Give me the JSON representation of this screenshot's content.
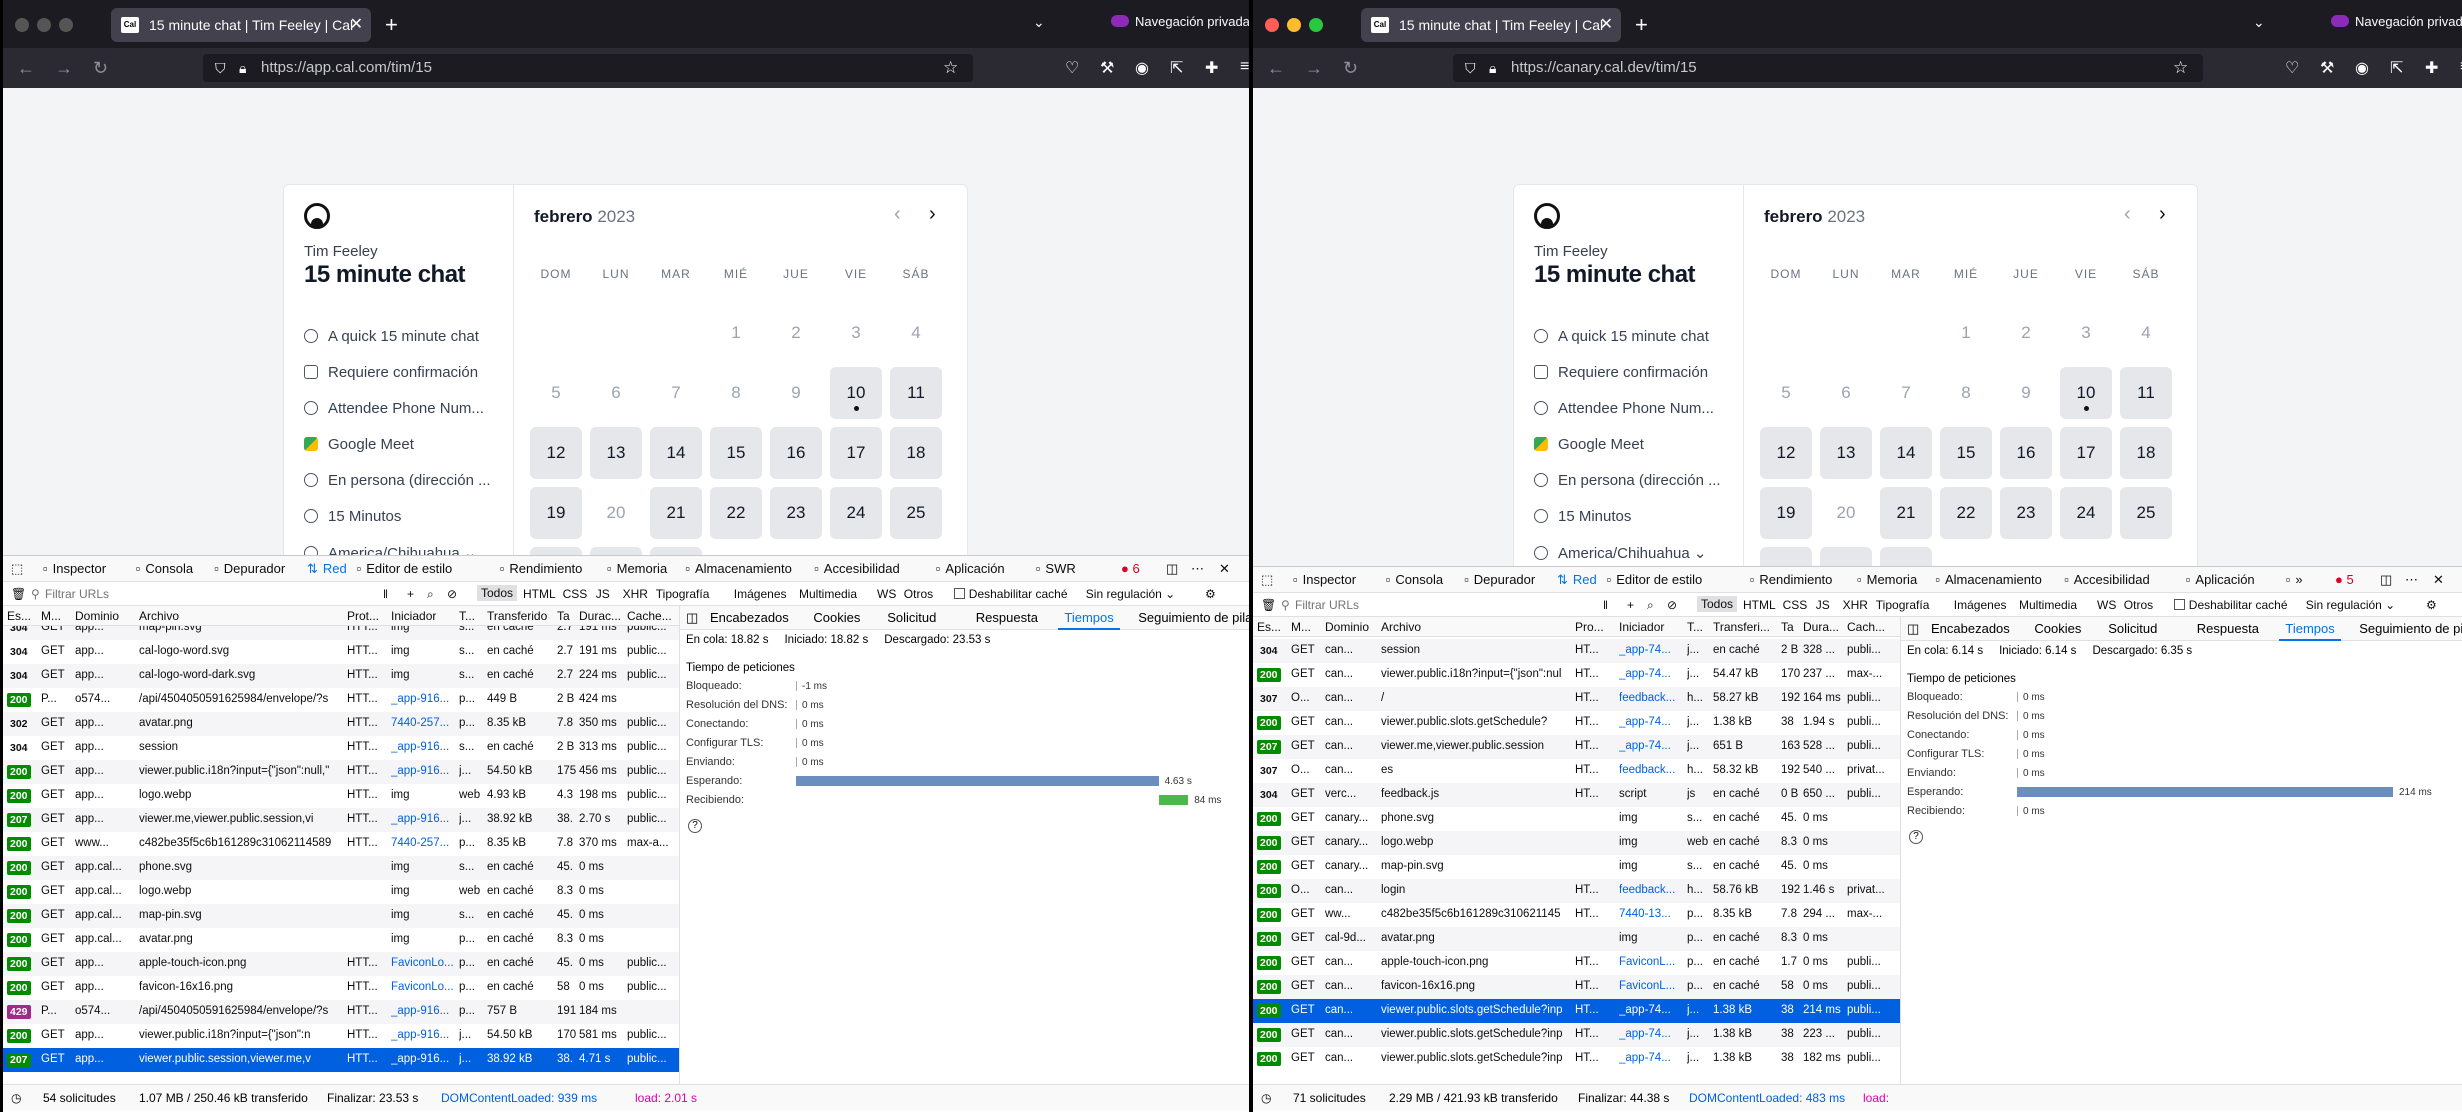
{
  "left": {
    "tab_title": "15 minute chat | Tim Feeley | Cal",
    "tab_close": "✕",
    "new_tab": "+",
    "chevron": "⌄",
    "private_label": "Navegación privada",
    "url": "https://app.cal.com/tim/15",
    "host_name": "Tim Feeley",
    "event_title": "15 minute chat",
    "info": [
      "A quick 15 minute chat",
      "Requiere confirmación",
      "Attendee Phone Num...",
      "Google Meet",
      "En persona (dirección ...",
      "15 Minutos",
      "America/Chihuahua ⌄"
    ],
    "month": "febrero",
    "year": "2023",
    "dow": [
      "DOM",
      "LUN",
      "MAR",
      "MIÉ",
      "JUE",
      "VIE",
      "SÁB"
    ],
    "devtools_tabs": [
      "Inspector",
      "Consola",
      "Depurador",
      "Red",
      "Editor de estilo",
      "Rendimiento",
      "Memoria",
      "Almacenamiento",
      "Accesibilidad",
      "Aplicación",
      "SWR"
    ],
    "error_count": "6",
    "filter_placeholder": "Filtrar URLs",
    "filter_types": [
      "Todos",
      "HTML",
      "CSS",
      "JS",
      "XHR",
      "Tipografía",
      "Imágenes",
      "Multimedia",
      "WS",
      "Otros"
    ],
    "disable_cache": "Deshabilitar caché",
    "throttle": "Sin regulación ⌄",
    "columns": [
      "Es...",
      "M...",
      "Dominio",
      "Archivo",
      "Prot...",
      "Iniciador",
      "T...",
      "Transferido",
      "Ta",
      "Durac...",
      "Cache..."
    ],
    "rows": [
      [
        "304",
        "GET",
        "app...",
        "map-pin.svg",
        "HTT...",
        "img",
        "s...",
        "en caché",
        "2.7",
        "191 ms",
        "public..."
      ],
      [
        "304",
        "GET",
        "app...",
        "cal-logo-word.svg",
        "HTT...",
        "img",
        "s...",
        "en caché",
        "2.7",
        "191 ms",
        "public..."
      ],
      [
        "304",
        "GET",
        "app...",
        "cal-logo-word-dark.svg",
        "HTT...",
        "img",
        "s...",
        "en caché",
        "2.7",
        "224 ms",
        "public..."
      ],
      [
        "200",
        "P...",
        "o574...",
        "/api/4504050591625984/envelope/?s",
        "HTT...",
        "_app-916...",
        "p...",
        "449 B",
        "2 B",
        "424 ms",
        ""
      ],
      [
        "302",
        "GET",
        "app...",
        "avatar.png",
        "HTT...",
        "7440-257...",
        "p...",
        "8.35 kB",
        "7.8",
        "350 ms",
        "public..."
      ],
      [
        "304",
        "GET",
        "app...",
        "session",
        "HTT...",
        "_app-916...",
        "s...",
        "en caché",
        "2 B",
        "313 ms",
        "public..."
      ],
      [
        "200",
        "GET",
        "app...",
        "viewer.public.i18n?input={\"json\":null,\"",
        "HTT...",
        "_app-916...",
        "j...",
        "54.50 kB",
        "175",
        "456 ms",
        "public..."
      ],
      [
        "200",
        "GET",
        "app...",
        "logo.webp",
        "HTT...",
        "img",
        "web",
        "4.93 kB",
        "4.3",
        "198 ms",
        "public..."
      ],
      [
        "207",
        "GET",
        "app...",
        "viewer.me,viewer.public.session,vi",
        "HTT...",
        "_app-916...",
        "j...",
        "38.92 kB",
        "38.",
        "2.70 s",
        "public..."
      ],
      [
        "200",
        "GET",
        "www...",
        "c482be35f5c6b161289c31062114589",
        "HTT...",
        "7440-257...",
        "p...",
        "8.35 kB",
        "7.8",
        "370 ms",
        "max-a..."
      ],
      [
        "200",
        "GET",
        "app.cal...",
        "phone.svg",
        "",
        "img",
        "s...",
        "en caché",
        "45.",
        "0 ms",
        ""
      ],
      [
        "200",
        "GET",
        "app.cal...",
        "logo.webp",
        "",
        "img",
        "web",
        "en caché",
        "8.3",
        "0 ms",
        ""
      ],
      [
        "200",
        "GET",
        "app.cal...",
        "map-pin.svg",
        "",
        "img",
        "s...",
        "en caché",
        "45.",
        "0 ms",
        ""
      ],
      [
        "200",
        "GET",
        "app.cal...",
        "avatar.png",
        "",
        "img",
        "p...",
        "en caché",
        "8.3",
        "0 ms",
        ""
      ],
      [
        "200",
        "GET",
        "app...",
        "apple-touch-icon.png",
        "HTT...",
        "FaviconLo...",
        "p...",
        "en caché",
        "45.",
        "0 ms",
        "public..."
      ],
      [
        "200",
        "GET",
        "app...",
        "favicon-16x16.png",
        "HTT...",
        "FaviconLo...",
        "p...",
        "en caché",
        "58",
        "0 ms",
        "public..."
      ],
      [
        "429",
        "P...",
        "o574...",
        "/api/4504050591625984/envelope/?s",
        "HTT...",
        "_app-916...",
        "p...",
        "757 B",
        "191",
        "184 ms",
        ""
      ],
      [
        "200",
        "GET",
        "app...",
        "viewer.public.i18n?input={\"json\":n",
        "HTT...",
        "_app-916...",
        "j...",
        "54.50 kB",
        "170",
        "581 ms",
        "public..."
      ],
      [
        "207",
        "GET",
        "app...",
        "viewer.public.session,viewer.me,v",
        "HTT...",
        "_app-916...",
        "j...",
        "38.92 kB",
        "38.",
        "4.71 s",
        "public..."
      ]
    ],
    "side_tabs": [
      "Encabezados",
      "Cookies",
      "Solicitud",
      "Respuesta",
      "Tiempos",
      "Seguimiento de pila"
    ],
    "queued": "En cola: 18.82 s",
    "started": "Iniciado: 18.82 s",
    "downloaded": "Descargado: 23.53 s",
    "timing_title": "Tiempo de peticiones",
    "timings": [
      {
        "label": "Bloqueado:",
        "value": "-1 ms",
        "bar": 0
      },
      {
        "label": "Resolución del DNS:",
        "value": "0 ms",
        "bar": 0
      },
      {
        "label": "Conectando:",
        "value": "0 ms",
        "bar": 0
      },
      {
        "label": "Configurar TLS:",
        "value": "0 ms",
        "bar": 0
      },
      {
        "label": "Enviando:",
        "value": "0 ms",
        "bar": 0
      },
      {
        "label": "Esperando:",
        "value": "4.63 s",
        "bar": 0.98
      },
      {
        "label": "Recibiendo:",
        "value": "84 ms",
        "bar": 0.02
      }
    ],
    "status_requests": "54 solicitudes",
    "status_size": "1.07 MB / 250.46 kB transferido",
    "status_finish": "Finalizar: 23.53 s",
    "status_dcl": "DOMContentLoaded: 939 ms",
    "status_load": "load: 2.01 s"
  },
  "right": {
    "tab_title": "15 minute chat | Tim Feeley | Cal",
    "tab_close": "✕",
    "new_tab": "+",
    "chevron": "⌄",
    "private_label": "Navegación privada",
    "url": "https://canary.cal.dev/tim/15",
    "host_name": "Tim Feeley",
    "event_title": "15 minute chat",
    "info": [
      "A quick 15 minute chat",
      "Requiere confirmación",
      "Attendee Phone Num...",
      "Google Meet",
      "En persona (dirección ...",
      "15 Minutos",
      "America/Chihuahua ⌄"
    ],
    "month": "febrero",
    "year": "2023",
    "dow": [
      "DOM",
      "LUN",
      "MAR",
      "MIÉ",
      "JUE",
      "VIE",
      "SÁB"
    ],
    "devtools_tabs": [
      "Inspector",
      "Consola",
      "Depurador",
      "Red",
      "Editor de estilo",
      "Rendimiento",
      "Memoria",
      "Almacenamiento",
      "Accesibilidad",
      "Aplicación",
      "»"
    ],
    "error_count": "5",
    "filter_placeholder": "Filtrar URLs",
    "filter_types": [
      "Todos",
      "HTML",
      "CSS",
      "JS",
      "XHR",
      "Tipografía",
      "Imágenes",
      "Multimedia",
      "WS",
      "Otros"
    ],
    "disable_cache": "Deshabilitar caché",
    "throttle": "Sin regulación ⌄",
    "columns": [
      "Es...",
      "M...",
      "Dominio",
      "Archivo",
      "Pro...",
      "Iniciador",
      "T...",
      "Transferi...",
      "Ta",
      "Dura...",
      "Cach..."
    ],
    "rows": [
      [
        "304",
        "GET",
        "can...",
        "session",
        "HT...",
        "_app-74...",
        "j...",
        "en caché",
        "2 B",
        "328 ...",
        "publi..."
      ],
      [
        "200",
        "GET",
        "can...",
        "viewer.public.i18n?input={\"json\":nul",
        "HT...",
        "_app-74...",
        "j...",
        "54.47 kB",
        "170",
        "237 ...",
        "max-..."
      ],
      [
        "307",
        "O...",
        "can...",
        "/",
        "HT...",
        "feedback...",
        "h...",
        "58.27 kB",
        "192",
        "164 ms",
        "publi..."
      ],
      [
        "200",
        "GET",
        "can...",
        "viewer.public.slots.getSchedule?",
        "HT...",
        "_app-74...",
        "j...",
        "1.38 kB",
        "38",
        "1.94 s",
        "publi..."
      ],
      [
        "207",
        "GET",
        "can...",
        "viewer.me,viewer.public.session",
        "HT...",
        "_app-74...",
        "j...",
        "651 B",
        "163",
        "528 ...",
        "publi..."
      ],
      [
        "307",
        "O...",
        "can...",
        "es",
        "HT...",
        "feedback...",
        "h...",
        "58.32 kB",
        "192",
        "540 ...",
        "privat..."
      ],
      [
        "304",
        "GET",
        "verc...",
        "feedback.js",
        "HT...",
        "script",
        "js",
        "en caché",
        "0 B",
        "650 ...",
        "publi..."
      ],
      [
        "200",
        "GET",
        "canary...",
        "phone.svg",
        "",
        "img",
        "s...",
        "en caché",
        "45.",
        "0 ms",
        ""
      ],
      [
        "200",
        "GET",
        "canary...",
        "logo.webp",
        "",
        "img",
        "web",
        "en caché",
        "8.3",
        "0 ms",
        ""
      ],
      [
        "200",
        "GET",
        "canary...",
        "map-pin.svg",
        "",
        "img",
        "s...",
        "en caché",
        "45.",
        "0 ms",
        ""
      ],
      [
        "200",
        "O...",
        "can...",
        "login",
        "HT...",
        "feedback...",
        "h...",
        "58.76 kB",
        "192",
        "1.46 s",
        "privat..."
      ],
      [
        "200",
        "GET",
        "ww...",
        "c482be35f5c6b161289c310621145",
        "HT...",
        "7440-13...",
        "p...",
        "8.35 kB",
        "7.8",
        "294 ...",
        "max-..."
      ],
      [
        "200",
        "GET",
        "cal-9d...",
        "avatar.png",
        "",
        "img",
        "p...",
        "en caché",
        "8.3",
        "0 ms",
        ""
      ],
      [
        "200",
        "GET",
        "can...",
        "apple-touch-icon.png",
        "HT...",
        "FaviconL...",
        "p...",
        "en caché",
        "1.7",
        "0 ms",
        "publi..."
      ],
      [
        "200",
        "GET",
        "can...",
        "favicon-16x16.png",
        "HT...",
        "FaviconL...",
        "p...",
        "en caché",
        "58",
        "0 ms",
        "publi..."
      ],
      [
        "200",
        "GET",
        "can...",
        "viewer.public.slots.getSchedule?inp",
        "HT...",
        "_app-74...",
        "j...",
        "1.38 kB",
        "38",
        "214 ms",
        "publi..."
      ],
      [
        "200",
        "GET",
        "can...",
        "viewer.public.slots.getSchedule?inp",
        "HT...",
        "_app-74...",
        "j...",
        "1.38 kB",
        "38",
        "223 ...",
        "publi..."
      ],
      [
        "200",
        "GET",
        "can...",
        "viewer.public.slots.getSchedule?inp",
        "HT...",
        "_app-74...",
        "j...",
        "1.38 kB",
        "38",
        "182 ms",
        "publi..."
      ]
    ],
    "side_tabs": [
      "Encabezados",
      "Cookies",
      "Solicitud",
      "Respuesta",
      "Tiempos",
      "Seguimiento de pila"
    ],
    "queued": "En cola: 6.14 s",
    "started": "Iniciado: 6.14 s",
    "downloaded": "Descargado: 6.35 s",
    "timing_title": "Tiempo de peticiones",
    "timings": [
      {
        "label": "Bloqueado:",
        "value": "0 ms",
        "bar": 0
      },
      {
        "label": "Resolución del DNS:",
        "value": "0 ms",
        "bar": 0
      },
      {
        "label": "Conectando:",
        "value": "0 ms",
        "bar": 0
      },
      {
        "label": "Configurar TLS:",
        "value": "0 ms",
        "bar": 0
      },
      {
        "label": "Enviando:",
        "value": "0 ms",
        "bar": 0
      },
      {
        "label": "Esperando:",
        "value": "214 ms",
        "bar": 1.0
      },
      {
        "label": "Recibiendo:",
        "value": "0 ms",
        "bar": 0
      }
    ],
    "status_requests": "71 solicitudes",
    "status_size": "2.29 MB / 421.93 kB transferido",
    "status_finish": "Finalizar: 44.38 s",
    "status_dcl": "DOMContentLoaded: 483 ms",
    "status_load": "load:"
  },
  "colors": {
    "accent": "#0074e8",
    "status_green": "#058b00",
    "status_purple": "#a0298a",
    "wait_bar": "#6c8ebf",
    "recv_bar": "#4cb84c",
    "private_purple": "#8c2bb8"
  }
}
